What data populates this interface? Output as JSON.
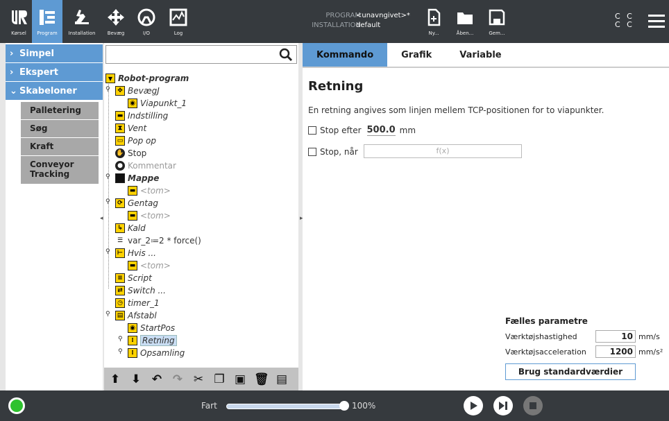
{
  "topbar": {
    "left_buttons": [
      {
        "label": "Kørsel",
        "icon": "ur-logo-icon"
      },
      {
        "label": "Program",
        "icon": "program-icon"
      },
      {
        "label": "Installation",
        "icon": "installation-icon"
      },
      {
        "label": "Bevæg",
        "icon": "move-icon"
      },
      {
        "label": "I/O",
        "icon": "io-icon"
      },
      {
        "label": "Log",
        "icon": "log-icon"
      }
    ],
    "program_key": "PROGRAM",
    "program_val": "<unavngivet>*",
    "install_key": "INSTALLATION",
    "install_val": "default",
    "file_buttons": [
      {
        "label": "Ny...",
        "icon": "new-file-icon"
      },
      {
        "label": "Åben...",
        "icon": "open-folder-icon"
      },
      {
        "label": "Gem...",
        "icon": "save-icon"
      }
    ],
    "cc_line1": "C C",
    "cc_line2": "C C"
  },
  "left_nav": {
    "items": [
      {
        "label": "Simpel"
      },
      {
        "label": "Ekspert"
      },
      {
        "label": "Skabeloner"
      }
    ],
    "sub_items": [
      "Palletering",
      "Søg",
      "Kraft",
      "Conveyor Tracking"
    ]
  },
  "tree": {
    "search_placeholder": "",
    "nodes": [
      "Robot-program",
      "BevægJ",
      "Viapunkt_1",
      "Indstilling",
      "Vent",
      "Pop op",
      "Stop",
      "Kommentar",
      "Mappe",
      "<tom>",
      "Gentag",
      "<tom>",
      "Kald",
      "var_2≔2 * force()",
      "Hvis ...",
      "<tom>",
      "Script",
      "Switch ...",
      "timer_1",
      "Afstabl",
      "StartPos",
      "Retning",
      "Opsamling"
    ]
  },
  "right": {
    "tabs": [
      "Kommando",
      "Grafik",
      "Variable"
    ],
    "title": "Retning",
    "description": "En retning angives som linjen mellem TCP-positionen for to viapunkter.",
    "stop_after_label": "Stop efter",
    "stop_after_value": "500.0",
    "stop_after_unit": "mm",
    "stop_when_label": "Stop, når",
    "fx_label": "f(x)",
    "common_title": "Fælles parametre",
    "tool_speed_label": "Værktøjshastighed",
    "tool_speed_value": "10",
    "tool_speed_unit": "mm/s",
    "tool_acc_label": "Værktøjsacceleration",
    "tool_acc_value": "1200",
    "tool_acc_unit": "mm/s²",
    "default_button": "Brug standardværdier"
  },
  "bottom": {
    "speed_label": "Fart",
    "speed_pct": "100%",
    "speed_fraction": 1.0
  },
  "colors": {
    "accent": "#5e9ad3",
    "topbar": "#363a3e",
    "yellow": "#ffd200",
    "status_green": "#2ec22e"
  }
}
